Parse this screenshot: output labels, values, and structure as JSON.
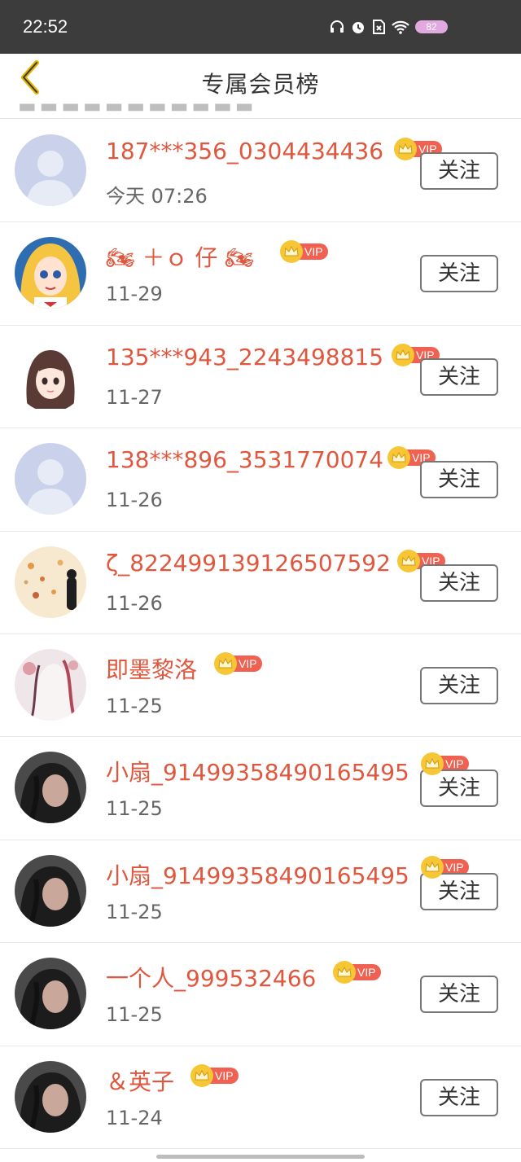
{
  "status_bar": {
    "time": "22:52",
    "battery": "82",
    "icons": [
      "headphones-icon",
      "alarm-icon",
      "no-sim-icon",
      "wifi-icon",
      "battery-icon"
    ]
  },
  "header": {
    "title": "专属会员榜",
    "back_icon": "chevron-left-icon"
  },
  "vip_label": "VIP",
  "follow_label": "关注",
  "members": [
    {
      "name": "187***356_0304434436",
      "date": "今天  07:26",
      "avatar": "default-avatar"
    },
    {
      "name": "🏍 ＋ｏ 仔 🏍",
      "date": "11-29",
      "avatar": "anime-girl-avatar"
    },
    {
      "name": "135***943_2243498815",
      "date": "11-27",
      "avatar": "girl-illustration-avatar"
    },
    {
      "name": "138***896_3531770074",
      "date": "11-26",
      "avatar": "default-avatar"
    },
    {
      "name": "ζ_822499139126507592",
      "date": "11-26",
      "avatar": "autumn-leaves-avatar"
    },
    {
      "name": "即墨黎洛",
      "date": "11-25",
      "avatar": "ink-painting-avatar"
    },
    {
      "name": "小扇_914993584901654​95",
      "date": "11-25",
      "avatar": "photo-avatar"
    },
    {
      "name": "小扇_91499358490165495",
      "date": "11-25",
      "avatar": "photo-avatar"
    },
    {
      "name": "一个人_999532466",
      "date": "11-25",
      "avatar": "photo-avatar"
    },
    {
      "name": "＆英子",
      "date": "11-24",
      "avatar": "photo-avatar"
    }
  ],
  "colors": {
    "name": "#e0573e",
    "vip_crown": "#f6c634",
    "vip_pill": "#f06151",
    "status_bar": "#3c3c3c"
  }
}
